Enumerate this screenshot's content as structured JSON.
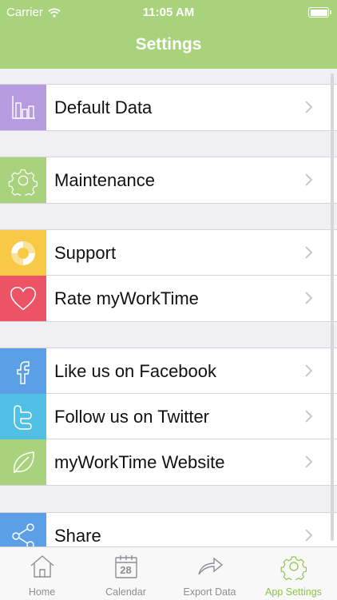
{
  "status": {
    "carrier": "Carrier",
    "time": "11:05 AM"
  },
  "header": {
    "title": "Settings"
  },
  "rows": [
    {
      "label": "Default Data",
      "icon": "bar-chart-icon",
      "color": "#b69be0"
    },
    {
      "label": "Maintenance",
      "icon": "gear-icon",
      "color": "#a8d27b"
    },
    {
      "label": "Support",
      "icon": "lifebuoy-icon",
      "color": "#f8c945"
    },
    {
      "label": "Rate myWorkTime",
      "icon": "heart-icon",
      "color": "#ec5466"
    },
    {
      "label": "Like us on Facebook",
      "icon": "facebook-icon",
      "color": "#5b9fe6"
    },
    {
      "label": "Follow us on Twitter",
      "icon": "twitter-icon",
      "color": "#52c0e4"
    },
    {
      "label": "myWorkTime Website",
      "icon": "leaf-icon",
      "color": "#a8d27b"
    },
    {
      "label": "Share",
      "icon": "share-icon",
      "color": "#5b9fe6"
    }
  ],
  "tabs": [
    {
      "label": "Home",
      "icon": "home-icon"
    },
    {
      "label": "Calendar",
      "icon": "calendar-icon",
      "day": "28"
    },
    {
      "label": "Export Data",
      "icon": "export-arrow-icon"
    },
    {
      "label": "App Settings",
      "icon": "gear-icon",
      "active": true
    }
  ],
  "colors": {
    "header": "#a8d27b",
    "active_tab": "#8cc44a",
    "inactive_tab": "#8e8e93"
  }
}
